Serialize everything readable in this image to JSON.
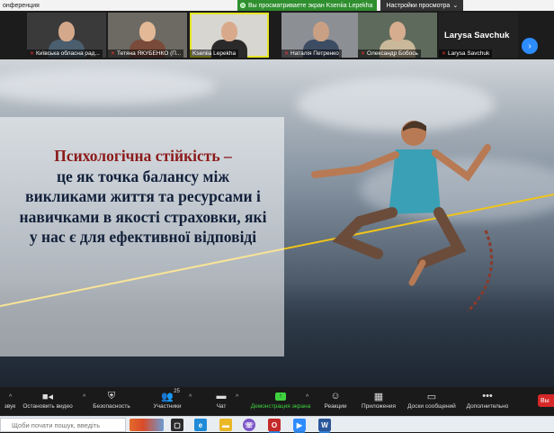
{
  "window": {
    "title": "онференция"
  },
  "share_banner": {
    "text": "Вы просматриваете экран Kseniia Lepekha",
    "view_options": "Настройки просмотра"
  },
  "participants": [
    {
      "name": "Київська обласна рад...",
      "muted": true
    },
    {
      "name": "Тетяна ЯКУБЕНКО (П...",
      "muted": true
    },
    {
      "name": "Kseniia Lepekha",
      "muted": false,
      "active": true
    },
    {
      "name": "Наталія Петренко",
      "muted": true
    },
    {
      "name": "Олександр Бобось",
      "muted": true
    },
    {
      "name": "Larysa Savchuk",
      "muted": true,
      "video": false
    }
  ],
  "slide": {
    "heading": "Психологічна стійкість –",
    "lines": [
      "це як точка балансу між",
      "викликами життя та ресурсами і",
      "навичками в якості страховки, які",
      "у нас є для ефективної відповіді"
    ]
  },
  "toolbar": {
    "audio_label": "звук",
    "video_label": "Остановить видео",
    "security_label": "Безопасность",
    "participants_label": "Участники",
    "participants_count": "25",
    "chat_label": "Чат",
    "share_label": "Демонстрация экрана",
    "reactions_label": "Реакции",
    "apps_label": "Приложения",
    "whiteboard_label": "Доски сообщений",
    "more_label": "Дополнительно",
    "end_label": "Вы"
  },
  "taskbar": {
    "search_placeholder": "Щоби почати пошук, введіть"
  }
}
